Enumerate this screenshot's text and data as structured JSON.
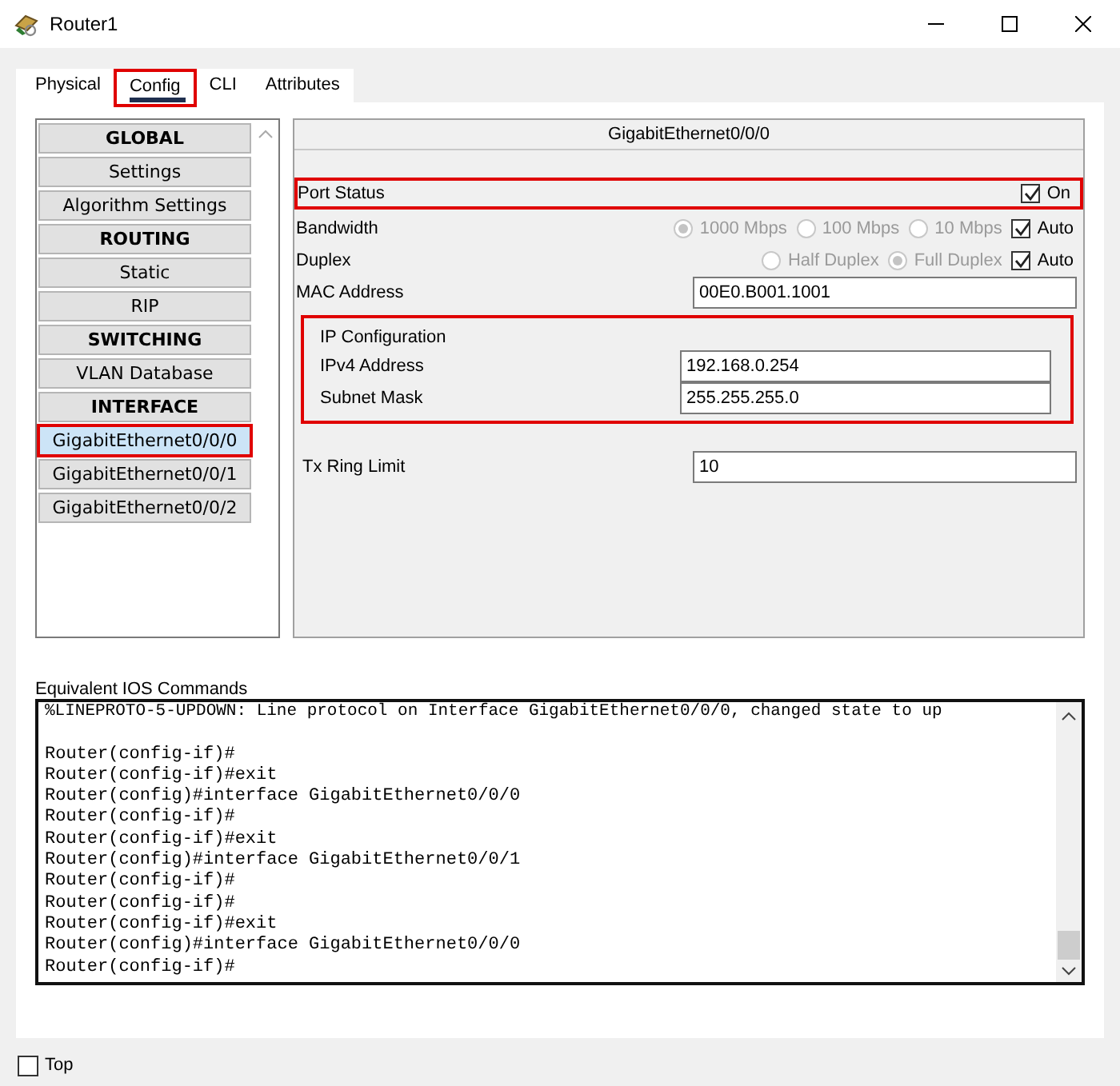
{
  "window": {
    "title": "Router1"
  },
  "tabs": [
    {
      "label": "Physical",
      "selected": false,
      "highlighted": false
    },
    {
      "label": "Config",
      "selected": true,
      "highlighted": true
    },
    {
      "label": "CLI",
      "selected": false,
      "highlighted": false
    },
    {
      "label": "Attributes",
      "selected": false,
      "highlighted": false
    }
  ],
  "sidebar": {
    "items": [
      {
        "kind": "header",
        "label": "GLOBAL"
      },
      {
        "kind": "item",
        "label": "Settings",
        "selected": false,
        "highlighted": false
      },
      {
        "kind": "item",
        "label": "Algorithm Settings",
        "selected": false,
        "highlighted": false
      },
      {
        "kind": "header",
        "label": "ROUTING"
      },
      {
        "kind": "item",
        "label": "Static",
        "selected": false,
        "highlighted": false
      },
      {
        "kind": "item",
        "label": "RIP",
        "selected": false,
        "highlighted": false
      },
      {
        "kind": "header",
        "label": "SWITCHING"
      },
      {
        "kind": "item",
        "label": "VLAN Database",
        "selected": false,
        "highlighted": false
      },
      {
        "kind": "header",
        "label": "INTERFACE"
      },
      {
        "kind": "item",
        "label": "GigabitEthernet0/0/0",
        "selected": true,
        "highlighted": true
      },
      {
        "kind": "item",
        "label": "GigabitEthernet0/0/1",
        "selected": false,
        "highlighted": false
      },
      {
        "kind": "item",
        "label": "GigabitEthernet0/0/2",
        "selected": false,
        "highlighted": false
      }
    ]
  },
  "interface_panel": {
    "title": "GigabitEthernet0/0/0",
    "port_status": {
      "label": "Port Status",
      "checkbox_label": "On",
      "checked": true,
      "highlighted": true
    },
    "bandwidth": {
      "label": "Bandwidth",
      "options": [
        {
          "label": "1000 Mbps",
          "selected": true
        },
        {
          "label": "100 Mbps",
          "selected": false
        },
        {
          "label": "10 Mbps",
          "selected": false
        }
      ],
      "disabled": true,
      "auto": {
        "label": "Auto",
        "checked": true
      }
    },
    "duplex": {
      "label": "Duplex",
      "options": [
        {
          "label": "Half Duplex",
          "selected": false
        },
        {
          "label": "Full Duplex",
          "selected": true
        }
      ],
      "disabled": true,
      "auto": {
        "label": "Auto",
        "checked": true
      }
    },
    "mac_address": {
      "label": "MAC Address",
      "value": "00E0.B001.1001"
    },
    "ip_configuration": {
      "title": "IP Configuration",
      "highlighted": true,
      "fields": [
        {
          "label": "IPv4 Address",
          "value": "192.168.0.254"
        },
        {
          "label": "Subnet Mask",
          "value": "255.255.255.0"
        }
      ]
    },
    "tx_ring_limit": {
      "label": "Tx Ring Limit",
      "value": "10"
    }
  },
  "ios_commands": {
    "label": "Equivalent IOS Commands",
    "status_message": "%LINEPROTO-5-UPDOWN: Line protocol on Interface GigabitEthernet0/0/0, changed state to up",
    "lines": [
      "Router(config-if)#",
      "Router(config-if)#exit",
      "Router(config)#interface GigabitEthernet0/0/0",
      "Router(config-if)#",
      "Router(config-if)#exit",
      "Router(config)#interface GigabitEthernet0/0/1",
      "Router(config-if)#",
      "Router(config-if)#",
      "Router(config-if)#exit",
      "Router(config)#interface GigabitEthernet0/0/0",
      "Router(config-if)#"
    ]
  },
  "top_checkbox": {
    "label": "Top",
    "checked": false
  }
}
